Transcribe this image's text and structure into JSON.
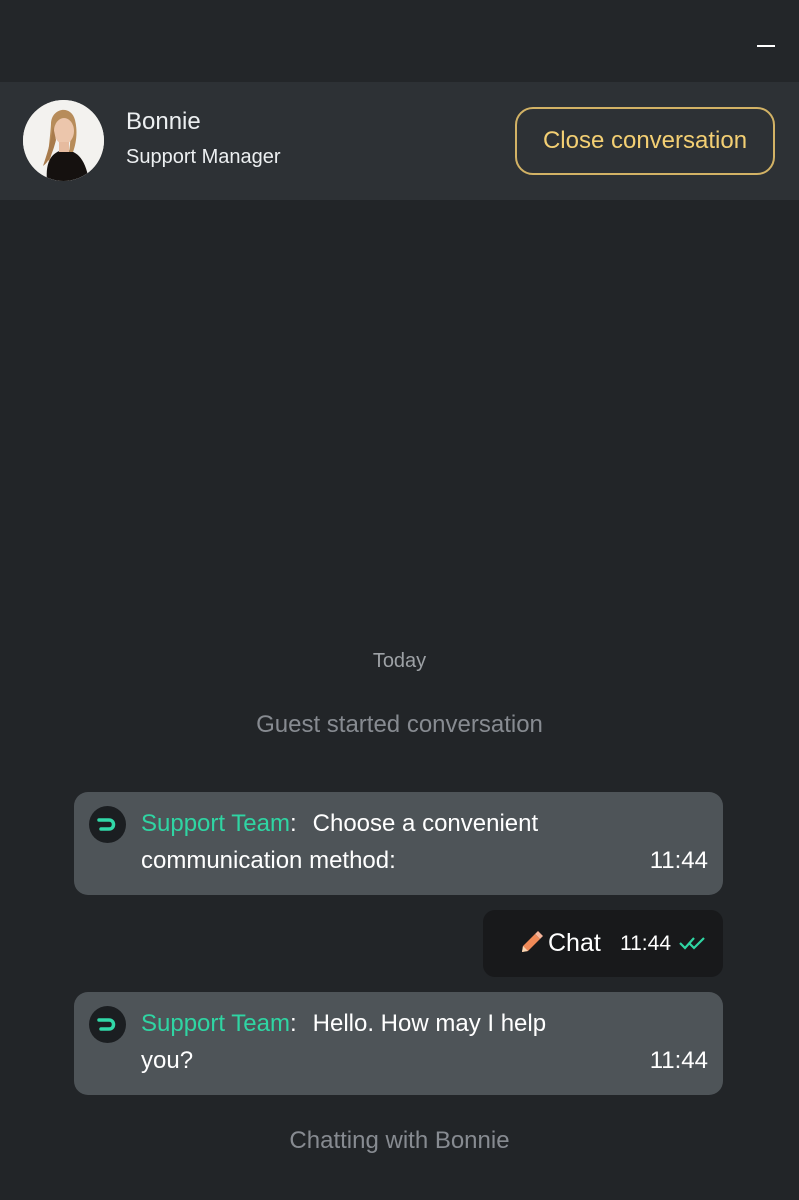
{
  "header": {
    "minimize_icon": "minimize-icon"
  },
  "agent": {
    "name": "Bonnie",
    "role": "Support Manager",
    "close_label": "Close conversation",
    "avatar_icon": "agent-avatar"
  },
  "conversation": {
    "day_label": "Today",
    "system_message": "Guest started conversation",
    "messages": [
      {
        "sender": "Support Team",
        "separator": ":",
        "line1": "Choose a convenient",
        "line2": "communication method:",
        "time": "11:44",
        "icon": "bot-logo-icon"
      },
      {
        "text": "Chat",
        "time": "11:44",
        "icon": "pencil-icon",
        "status_icon": "double-check-icon"
      },
      {
        "sender": "Support Team",
        "separator": ":",
        "line1": "Hello. How may I help",
        "line2": "you?",
        "time": "11:44",
        "icon": "bot-logo-icon"
      }
    ],
    "footer_status": "Chatting with Bonnie"
  },
  "colors": {
    "background": "#222528",
    "header_bar": "#2d3135",
    "accent_gold": "#f3cf73",
    "sender_green": "#2fd5a3",
    "bubble_gray": "#4e5458",
    "own_bubble": "#18191b"
  }
}
